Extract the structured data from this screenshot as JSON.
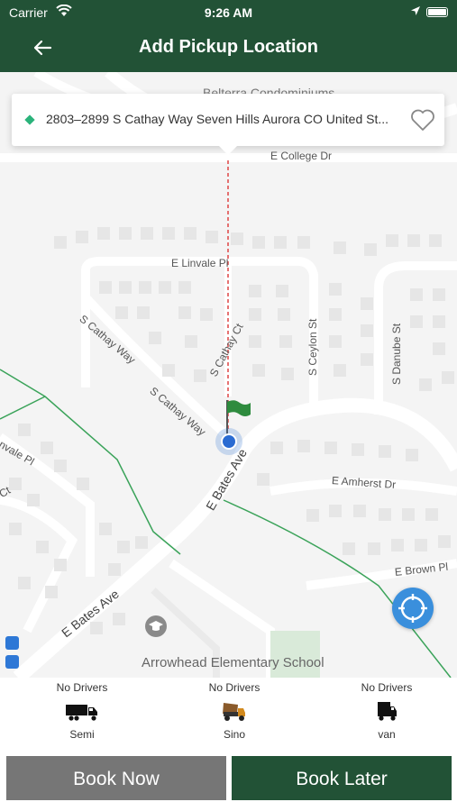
{
  "status_bar": {
    "carrier": "Carrier",
    "time": "9:26 AM"
  },
  "header": {
    "title": "Add Pickup Location"
  },
  "search": {
    "address": "2803–2899 S Cathay Way Seven Hills Aurora CO United St..."
  },
  "map": {
    "streets": {
      "college": "E College Dr",
      "linvale": "E Linvale Pl",
      "cathay_way_1": "S Cathay Way",
      "cathay_way_2": "S Cathay Way",
      "cathay_ct": "S Cathay Ct",
      "ceylon": "S Ceylon St",
      "danube": "S Danube St",
      "bates_1": "E Bates Ave",
      "bates_2": "E Bates Ave",
      "amherst": "E Amherst Dr",
      "brown": "E Brown Pl",
      "linvale_left": "nvale Pl",
      "ct_left": "Ct",
      "condos": "Belterra Condominiums",
      "school": "Arrowhead Elementary School"
    }
  },
  "vehicles": [
    {
      "status": "No Drivers",
      "name": "Semi",
      "icon": "semi-truck-icon"
    },
    {
      "status": "No Drivers",
      "name": "Sino",
      "icon": "dump-truck-icon"
    },
    {
      "status": "No Drivers",
      "name": "van",
      "icon": "van-icon"
    }
  ],
  "buttons": {
    "book_now": "Book Now",
    "book_later": "Book Later"
  },
  "colors": {
    "primary": "#225236",
    "secondary_button": "#767676",
    "accent": "#2bb37b",
    "locate": "#3a8fdc",
    "route_line": "#e05050"
  }
}
